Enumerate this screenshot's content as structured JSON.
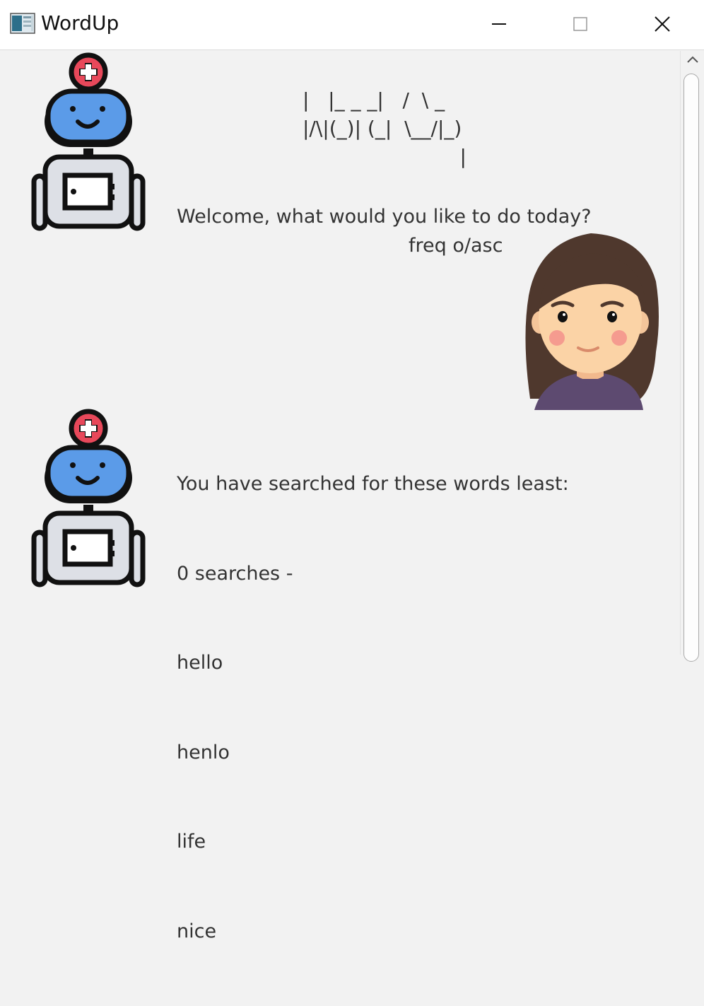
{
  "window": {
    "title": "WordUp",
    "controls": [
      "minimize-icon",
      "maximize-icon",
      "close-icon"
    ]
  },
  "chat": {
    "messages": [
      {
        "sender": "bot",
        "ascii_banner": [
          "|   |_ _ _|   /  \\ _",
          "|/\\|(_)| (_|  \\__/|_)",
          "                         |"
        ],
        "text": "Welcome, what would you like to do today?"
      },
      {
        "sender": "user",
        "text": "freq o/asc"
      },
      {
        "sender": "bot",
        "lines": [
          "You have searched for these words least:",
          "0 searches -",
          "hello",
          "henlo",
          "life",
          "nice"
        ]
      }
    ]
  },
  "icons": {
    "bot_avatar": "robot-avatar-icon",
    "user_avatar": "girl-avatar-icon"
  },
  "colors": {
    "robot_head": "#5b9be8",
    "robot_badge": "#e8485a",
    "user_hair": "#4f382d",
    "user_shirt": "#5d4a70"
  }
}
